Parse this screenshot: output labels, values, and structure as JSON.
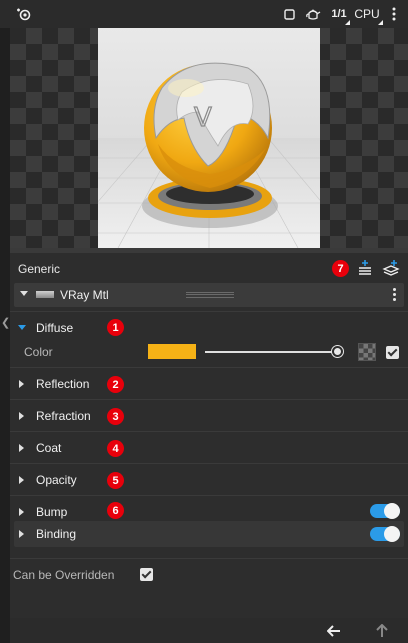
{
  "toolbar": {
    "ratio_label": "1/1",
    "engine_label": "CPU"
  },
  "panel": {
    "title": "Generic",
    "badge_7": "7",
    "material": {
      "name": "VRay Mtl"
    },
    "sections": [
      {
        "label": "Diffuse",
        "badge": "1",
        "expanded": true
      },
      {
        "label": "Reflection",
        "badge": "2",
        "expanded": false
      },
      {
        "label": "Refraction",
        "badge": "3",
        "expanded": false
      },
      {
        "label": "Coat",
        "badge": "4",
        "expanded": false
      },
      {
        "label": "Opacity",
        "badge": "5",
        "expanded": false
      },
      {
        "label": "Bump",
        "badge": "6",
        "expanded": false,
        "toggle_on": true
      },
      {
        "label": "Binding",
        "expanded": false,
        "toggle_on": true
      }
    ],
    "diffuse": {
      "color_label": "Color",
      "color_value": "#f6b216",
      "slider_fraction": 1.0,
      "texture_enabled": true
    },
    "override_label": "Can be Overridden",
    "override_checked": true
  },
  "colors": {
    "accent": "#2b9be8",
    "badge": "#e8000b",
    "swatch": "#f6b216"
  },
  "icons": [
    "render-settings-icon",
    "region-icon",
    "teapot-icon",
    "more-icon",
    "add-layer-icon",
    "add-material-layer-icon",
    "kebab-menu-icon",
    "back-arrow-icon",
    "upload-arrow-icon"
  ]
}
